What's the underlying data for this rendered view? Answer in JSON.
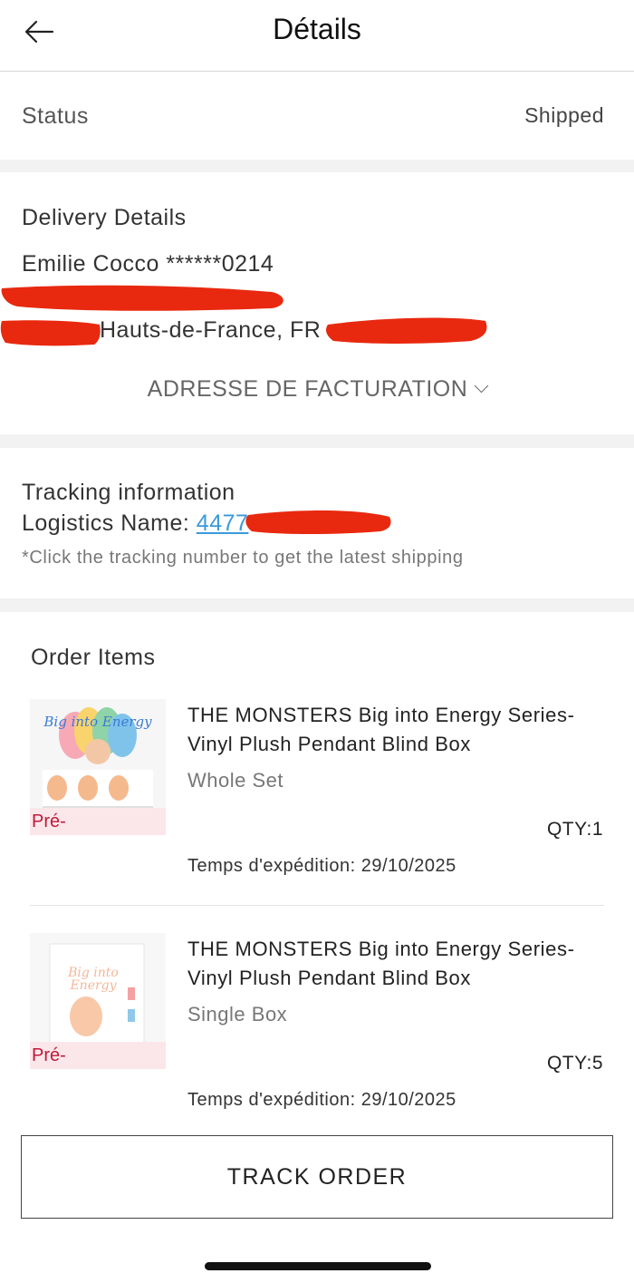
{
  "header": {
    "title": "Détails",
    "back_icon": "arrow-left-icon"
  },
  "status": {
    "label": "Status",
    "value": "Shipped"
  },
  "delivery": {
    "heading": "Delivery Details",
    "name_phone": "Emilie Cocco ******0214",
    "address_region": "Hauts-de-France, FR",
    "billing_toggle": "ADRESSE DE FACTURATION",
    "billing_icon": "chevron-down-icon"
  },
  "tracking": {
    "heading": "Tracking information",
    "logistics_label": "Logistics Name: ",
    "tracking_number_partial": "4477",
    "hint": "*Click the tracking number to get the latest shipping"
  },
  "order": {
    "heading": "Order Items",
    "items": [
      {
        "title": "THE MONSTERS Big into Energy Series-Vinyl Plush Pendant Blind Box",
        "variant": "Whole Set",
        "badge": "Pré-",
        "qty": "QTY:1",
        "shipping": "Temps d'expédition: 29/10/2025"
      },
      {
        "title": "THE MONSTERS Big into Energy Series-Vinyl Plush Pendant Blind Box",
        "variant": "Single Box",
        "badge": "Pré-",
        "qty": "QTY:5",
        "shipping": "Temps d'expédition: 29/10/2025"
      }
    ]
  },
  "actions": {
    "track_order": "TRACK ORDER"
  },
  "colors": {
    "link": "#3a9ad9",
    "badge_text": "#c0193a",
    "badge_bg": "#fbe7ea",
    "redaction": "#e8290f",
    "separator": "#f2f2f2"
  }
}
